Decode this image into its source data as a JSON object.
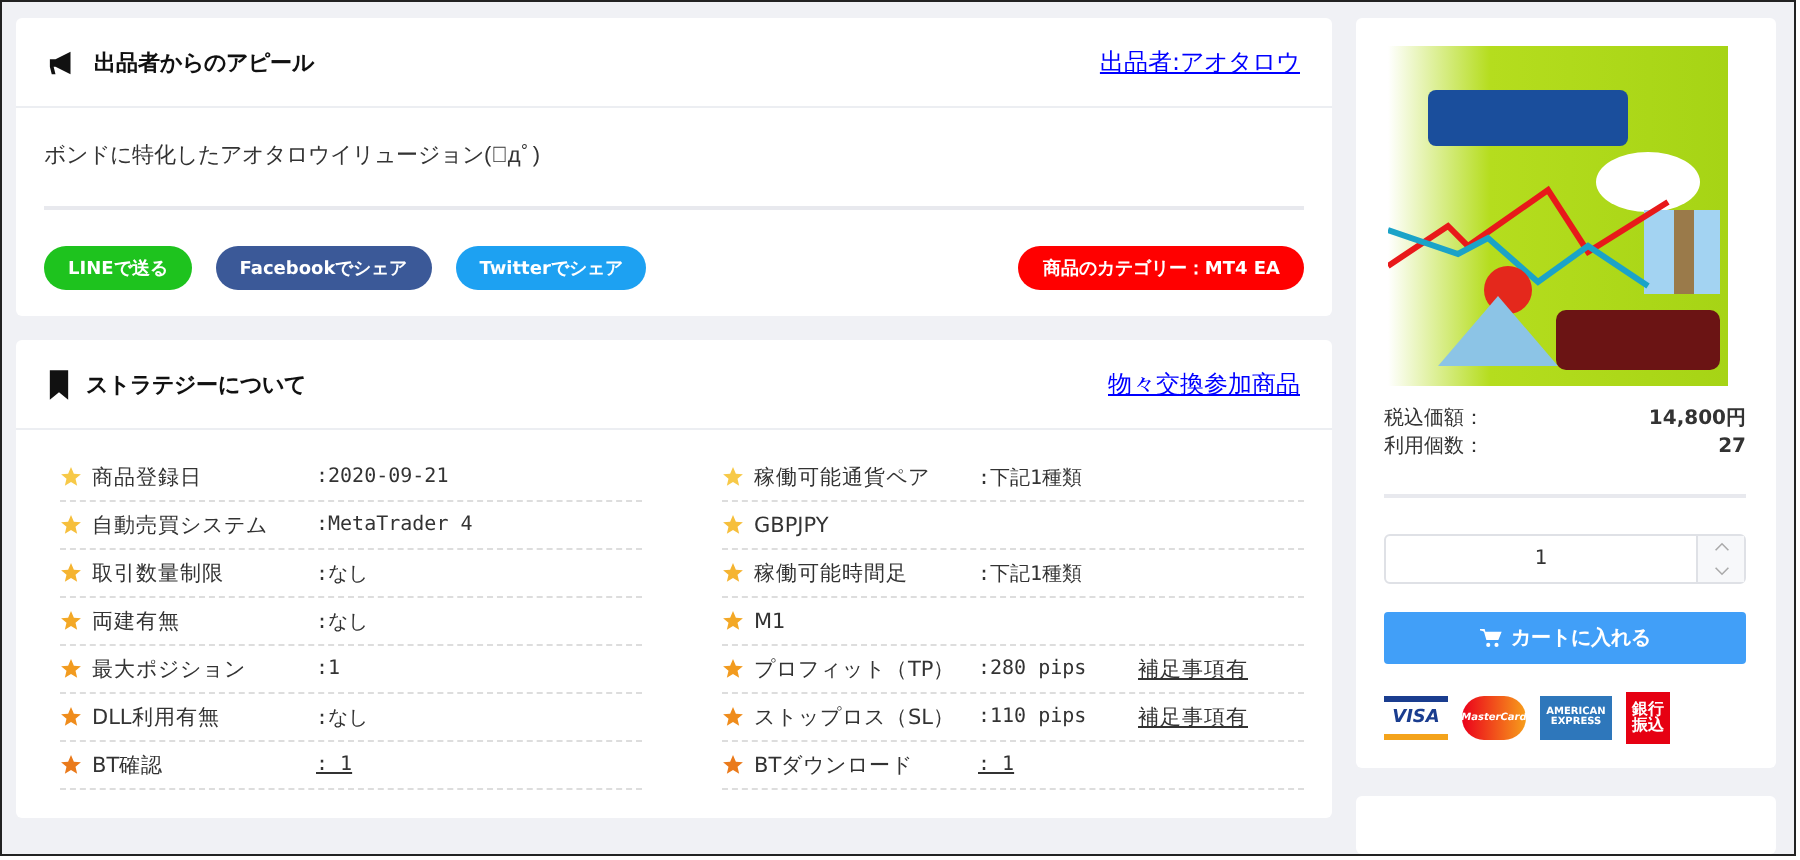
{
  "appeal": {
    "title": "出品者からのアピール",
    "seller_link": "出品者:アオタロウ",
    "text": "ボンドに特化したアオタロウイリュージョン(ﾟдﾟ)",
    "share_buttons": [
      {
        "label": "LINEで送る",
        "color": "#1ec31e"
      },
      {
        "label": "Facebookでシェア",
        "color": "#3b5998"
      },
      {
        "label": "Twitterでシェア",
        "color": "#1da1f2"
      }
    ],
    "category": "商品のカテゴリー：MT4 EA"
  },
  "strategy": {
    "title": "ストラテジーについて",
    "exchange_link": "物々交換参加商品",
    "left": [
      {
        "label": "商品登録日",
        "value": ":2020-09-21",
        "value_link": false,
        "color": "#f7c948"
      },
      {
        "label": "自動売買システム",
        "value": ":MetaTrader 4",
        "value_link": false,
        "color": "#f6bf3c"
      },
      {
        "label": "取引数量制限",
        "value": ":なし",
        "value_link": false,
        "color": "#f5b431"
      },
      {
        "label": "両建有無",
        "value": ":なし",
        "value_link": false,
        "color": "#f3a826"
      },
      {
        "label": "最大ポジション",
        "value": ":1",
        "value_link": false,
        "color": "#f29b1f"
      },
      {
        "label": "DLL利用有無",
        "value": ":なし",
        "value_link": false,
        "color": "#ef8c1c"
      },
      {
        "label": "BT確認",
        "value": ": 1",
        "value_link": true,
        "color": "#ea7a1b"
      }
    ],
    "right": [
      {
        "label": "稼働可能通貨ペア",
        "value": ":下記1種類",
        "value_link": false,
        "color": "#f7c948"
      },
      {
        "label": "GBPJPY",
        "color": "#f6bf3c"
      },
      {
        "label": "稼働可能時間足",
        "value": ":下記1種類",
        "value_link": false,
        "color": "#f5b431"
      },
      {
        "label": "M1",
        "color": "#f3a826"
      },
      {
        "label": "プロフィット（TP）",
        "value": ":280 pips",
        "value_link": false,
        "note": "補足事項有",
        "color": "#f29b1f"
      },
      {
        "label": "ストップロス（SL）",
        "value": ":110 pips",
        "value_link": false,
        "note": "補足事項有",
        "color": "#ef8c1c"
      },
      {
        "label": "BTダウンロード",
        "value": ": 1",
        "value_link": true,
        "color": "#ea7a1b"
      }
    ]
  },
  "purchase": {
    "price_label": "税込価額：",
    "price": "14,800円",
    "usage_label": "利用個数：",
    "usage": "27",
    "quantity": "1",
    "cart_button": "カートに入れる",
    "payments": [
      "VISA",
      "MasterCard",
      "AMERICAN EXPRESS",
      "銀行振込"
    ]
  }
}
